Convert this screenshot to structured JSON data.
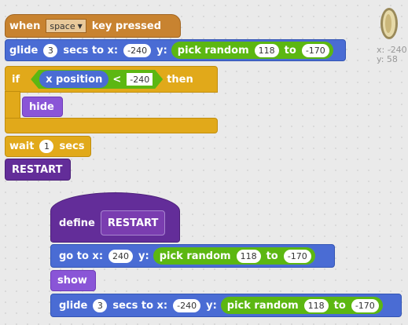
{
  "script1": {
    "when_key": {
      "when": "when",
      "key": "space",
      "pressed": "key pressed"
    },
    "glide1": {
      "glide": "glide",
      "secs": "3",
      "secs_to_x": "secs to x:",
      "x": "-240",
      "y_label": "y:",
      "pick_random": "pick random",
      "from": "118",
      "to": "to",
      "to_val": "-170"
    },
    "if_block": {
      "if": "if",
      "x_position": "x position",
      "lt": "<",
      "value": "-240",
      "then": "then"
    },
    "hide": "hide",
    "wait": {
      "wait": "wait",
      "secs": "1",
      "secs_label": "secs"
    },
    "restart_call": "RESTART"
  },
  "script2": {
    "define": "define",
    "name": "RESTART",
    "goto": {
      "label": "go to x:",
      "x": "240",
      "y_label": "y:",
      "pick_random": "pick random",
      "from": "118",
      "to": "to",
      "to_val": "-170"
    },
    "show": "show",
    "glide": {
      "glide": "glide",
      "secs": "3",
      "secs_to_x": "secs to x:",
      "x": "-240",
      "y_label": "y:",
      "pick_random": "pick random",
      "from": "118",
      "to": "to",
      "to_val": "-170"
    }
  },
  "sprite_info": {
    "x_label": "x:",
    "x_value": "-240",
    "y_label": "y:",
    "y_value": "58"
  },
  "colors": {
    "event": "#c88330",
    "motion": "#4a6cd4",
    "control": "#e1a91a",
    "looks": "#8a55d7",
    "more_blocks": "#632d99",
    "operators": "#5cb712"
  }
}
